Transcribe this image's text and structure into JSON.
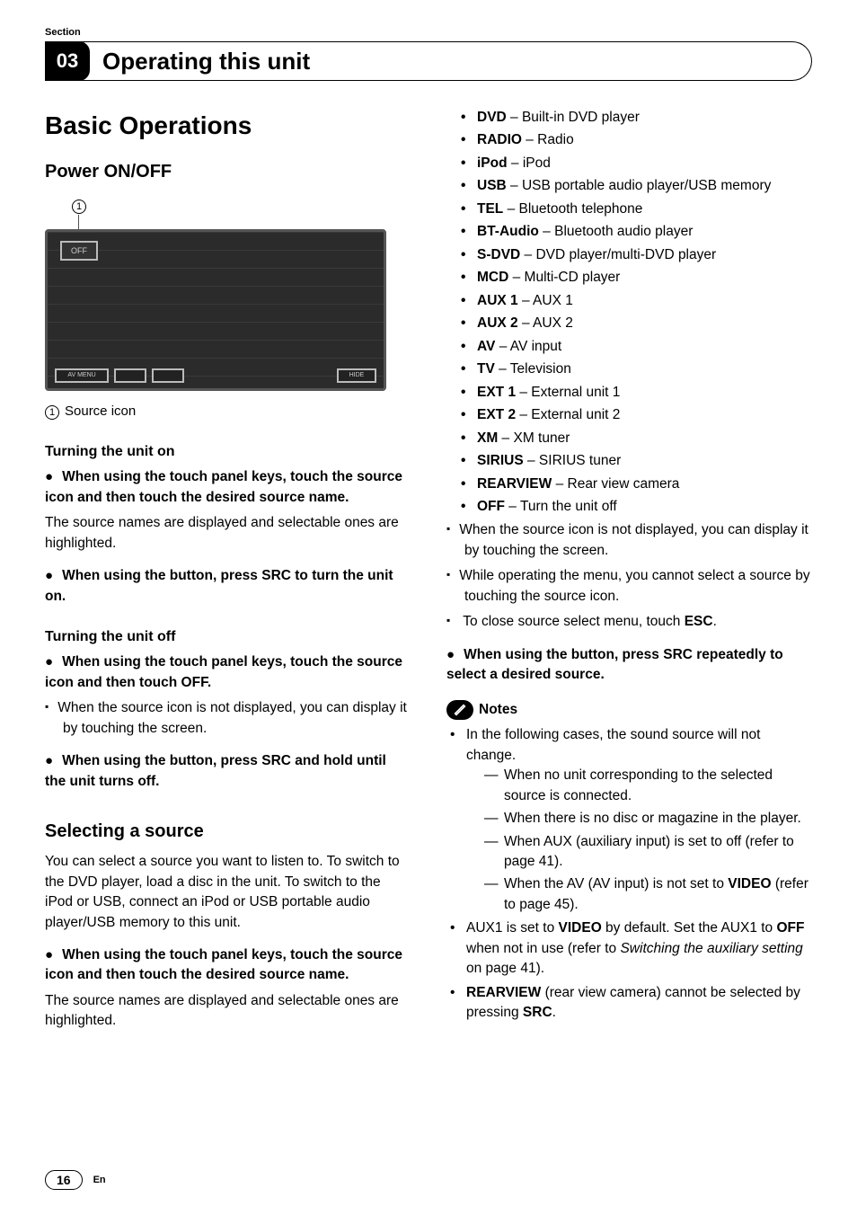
{
  "header": {
    "section_label": "Section",
    "section_num": "03",
    "chapter_title": "Operating this unit"
  },
  "left": {
    "h1": "Basic Operations",
    "h2_power": "Power ON/OFF",
    "callout_num": "1",
    "btn_off": "OFF",
    "btn_menu": "AV MENU",
    "btn_hide": "HIDE",
    "caption_num": "1",
    "caption_text": "Source icon",
    "h3_on": "Turning the unit on",
    "on_p1": "When using the touch panel keys, touch the source icon and then touch the desired source name.",
    "on_p2": "The source names are displayed and selectable ones are highlighted.",
    "on_p3": "When using the button, press SRC to turn the unit on.",
    "h3_off": "Turning the unit off",
    "off_p1": "When using the touch panel keys, touch the source icon and then touch OFF.",
    "off_p2": "When the source icon is not displayed, you can display it by touching the screen.",
    "off_p3": "When using the button, press SRC and hold until the unit turns off.",
    "h2_select": "Selecting a source",
    "sel_p1": "You can select a source you want to listen to. To switch to the DVD player, load a disc in the unit. To switch to the iPod or USB, connect an iPod or USB portable audio player/USB memory to this unit.",
    "sel_p2": "When using the touch panel keys, touch the source icon and then touch the desired source name.",
    "sel_p3": "The source names are displayed and selectable ones are highlighted."
  },
  "right": {
    "sources": [
      {
        "k": "DVD",
        "v": " – Built-in DVD player"
      },
      {
        "k": "RADIO",
        "v": " – Radio"
      },
      {
        "k": "iPod",
        "v": " – iPod"
      },
      {
        "k": "USB",
        "v": " – USB portable audio player/USB memory"
      },
      {
        "k": "TEL",
        "v": " – Bluetooth telephone"
      },
      {
        "k": "BT-Audio",
        "v": " – Bluetooth audio player"
      },
      {
        "k": "S-DVD",
        "v": " – DVD player/multi-DVD player"
      },
      {
        "k": "MCD",
        "v": " – Multi-CD player"
      },
      {
        "k": "AUX 1",
        "v": " – AUX 1"
      },
      {
        "k": "AUX 2",
        "v": " – AUX 2"
      },
      {
        "k": "AV",
        "v": " – AV input"
      },
      {
        "k": "TV",
        "v": " – Television"
      },
      {
        "k": "EXT 1",
        "v": " – External unit 1"
      },
      {
        "k": "EXT 2",
        "v": " – External unit 2"
      },
      {
        "k": "XM",
        "v": " – XM tuner"
      },
      {
        "k": "SIRIUS",
        "v": " – SIRIUS tuner"
      },
      {
        "k": "REARVIEW",
        "v": " – Rear view camera"
      },
      {
        "k": "OFF",
        "v": " – Turn the unit off"
      }
    ],
    "sq1": "When the source icon is not displayed, you can display it by touching the screen.",
    "sq2": "While operating the menu, you cannot select a source by touching the source icon.",
    "sq3_a": "To close source select menu, touch ",
    "sq3_b": "ESC",
    "sq3_c": ".",
    "action": "When using the button, press SRC repeatedly to select a desired source.",
    "notes_label": "Notes",
    "note1": "In the following cases, the sound source will not change.",
    "note1_sub": [
      "When no unit corresponding to the selected source is connected.",
      "When there is no disc or magazine in the player.",
      "When AUX (auxiliary input) is set to off (refer to page 41).",
      "When the AV (AV input) is not set to VIDEO (refer to page 45)."
    ],
    "note2_a": "AUX1 is set to ",
    "note2_b": "VIDEO",
    "note2_c": " by default. Set the AUX1 to ",
    "note2_d": "OFF",
    "note2_e": " when not in use (refer to ",
    "note2_f": "Switching the auxiliary setting",
    "note2_g": " on page 41).",
    "note3_a": "REARVIEW",
    "note3_b": " (rear view camera) cannot be selected by pressing ",
    "note3_c": "SRC",
    "note3_d": "."
  },
  "footer": {
    "page": "16",
    "lang": "En"
  }
}
